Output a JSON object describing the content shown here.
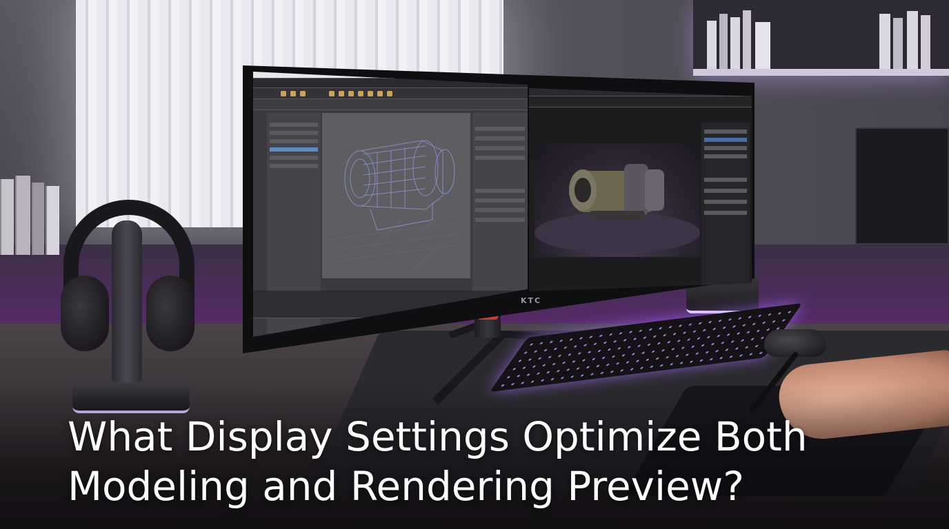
{
  "headline": {
    "line1": "What Display Settings Optimize Both",
    "line2": "Modeling and Rendering Preview?"
  },
  "monitor": {
    "brand": "KTC"
  },
  "colors": {
    "headline_text": "#ffffff",
    "ambient_glow": "#b03ee0",
    "keyboard_backlight": "#b89cff"
  }
}
